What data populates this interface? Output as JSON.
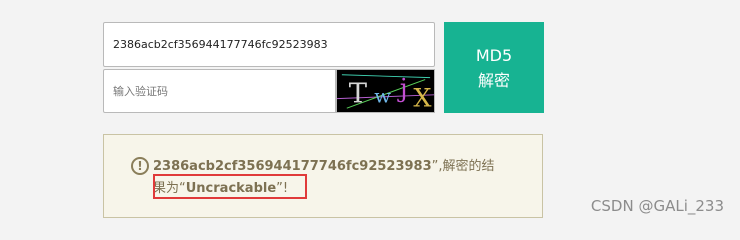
{
  "form": {
    "hash_value": "2386acb2cf356944177746fc92523983",
    "captcha_placeholder": "输入验证码",
    "captcha_text": "TwjX",
    "button_line1": "MD5",
    "button_line2": "解密"
  },
  "result": {
    "hash": "2386acb2cf356944177746fc92523983",
    "mid_text": "”,解密的结果为“",
    "status": "Uncrackable",
    "end_text": "”!"
  },
  "watermark": "CSDN @GALi_233",
  "colors": {
    "button": "#17b392",
    "result_bg": "#f7f5ea",
    "result_text": "#7d7152",
    "highlight": "#e03a3a"
  },
  "icons": {
    "alert": "exclamation-circle-icon"
  }
}
